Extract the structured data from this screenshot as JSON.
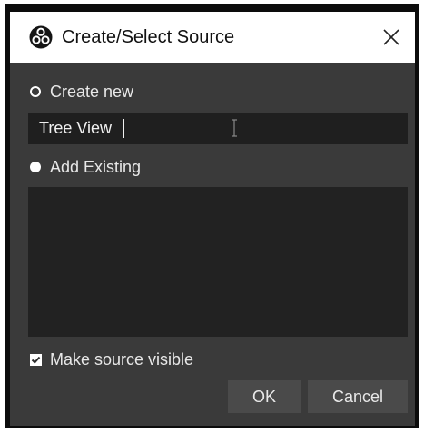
{
  "window": {
    "title": "Create/Select Source",
    "app_icon": "obs-logo-icon",
    "close_icon": "close-icon"
  },
  "create_new": {
    "label": "Create new",
    "selected": false
  },
  "name_input": {
    "value": "Tree View"
  },
  "add_existing": {
    "label": "Add Existing",
    "selected": true,
    "items": []
  },
  "make_visible": {
    "label": "Make source visible",
    "checked": true
  },
  "buttons": {
    "ok": "OK",
    "cancel": "Cancel"
  },
  "colors": {
    "dialog_bg": "#3a3a3a",
    "input_bg": "#1f1f1f",
    "list_bg": "#222222",
    "button_bg": "#4a4a4a",
    "titlebar_bg": "#ffffff"
  }
}
